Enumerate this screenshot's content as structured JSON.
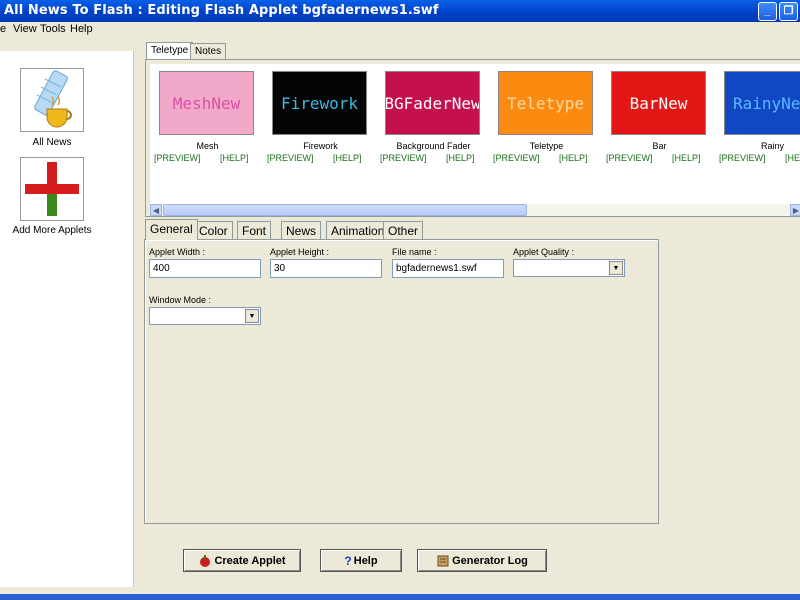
{
  "window": {
    "title": "All News To Flash : Editing Flash Applet bgfadernews1.swf",
    "minimize_glyph": "_",
    "restore_glyph": "❐"
  },
  "menu": {
    "items": [
      "e",
      "View",
      "Tools",
      "Help"
    ]
  },
  "sidebar": {
    "items": [
      {
        "label": "All News",
        "icon": "news-scroll-coffee-icon"
      },
      {
        "label": "Add More Applets",
        "icon": "red-plus-icon"
      }
    ]
  },
  "top_tabs": [
    "Teletype",
    "Notes"
  ],
  "applets": [
    {
      "name": "Mesh",
      "thumb_text": "MeshNew",
      "bg": "#f2a9c9",
      "fg": "#d94fa6",
      "preview": "[PREVIEW]",
      "help": "[HELP]"
    },
    {
      "name": "Firework",
      "thumb_text": "Firework",
      "bg": "#050505",
      "fg": "#3db9e0",
      "preview": "[PREVIEW]",
      "help": "[HELP]"
    },
    {
      "name": "Background Fader",
      "thumb_text": "BGFaderNew",
      "bg": "#c4104b",
      "fg": "#ffffff",
      "preview": "[PREVIEW]",
      "help": "[HELP]"
    },
    {
      "name": "Teletype",
      "thumb_text": "Teletype",
      "bg": "#fb8a10",
      "fg": "#ffd9a0",
      "preview": "[PREVIEW]",
      "help": "[HELP]"
    },
    {
      "name": "Bar",
      "thumb_text": "BarNew",
      "bg": "#e31515",
      "fg": "#ffffff",
      "preview": "[PREVIEW]",
      "help": "[HELP]"
    },
    {
      "name": "Rainy",
      "thumb_text": "RainyNew",
      "bg": "#1147c4",
      "fg": "#59b8ff",
      "preview": "[PREVIEW]",
      "help": "[HELP]"
    }
  ],
  "settings_tabs": [
    "General",
    "Color",
    "Font",
    "News",
    "Animation",
    "Other"
  ],
  "general": {
    "applet_width_label": "Applet Width :",
    "applet_width": "400",
    "applet_height_label": "Applet Height :",
    "applet_height": "30",
    "file_name_label": "File name :",
    "file_name": "bgfadernews1.swf",
    "applet_quality_label": "Applet Quality :",
    "applet_quality": "",
    "window_mode_label": "Window Mode :",
    "window_mode": ""
  },
  "buttons": {
    "create": "Create Applet",
    "help": "Help",
    "log": "Generator Log"
  }
}
